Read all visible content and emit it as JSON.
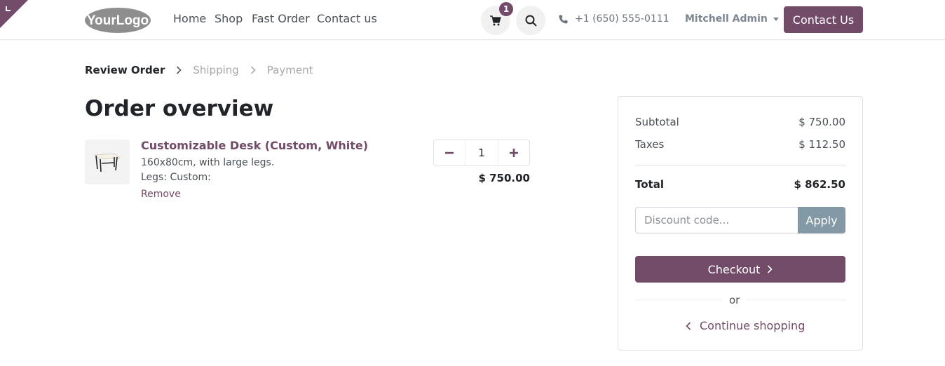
{
  "header": {
    "logo_text": "YourLogo",
    "nav": [
      "Home",
      "Shop",
      "Fast Order",
      "Contact us"
    ],
    "cart_count": "1",
    "phone": "+1 (650) 555-0111",
    "user": "Mitchell Admin",
    "contact_button": "Contact Us"
  },
  "steps": [
    "Review Order",
    "Shipping",
    "Payment"
  ],
  "page_title": "Order overview",
  "line_item": {
    "name": "Customizable Desk (Custom, White)",
    "description": "160x80cm, with large legs.",
    "attribute": "Legs: Custom:",
    "remove_label": "Remove",
    "quantity": "1",
    "price": "$ 750.00"
  },
  "summary": {
    "subtotal_label": "Subtotal",
    "subtotal": "$ 750.00",
    "taxes_label": "Taxes",
    "taxes": "$ 112.50",
    "total_label": "Total",
    "total": "$ 862.50",
    "discount_placeholder": "Discount code...",
    "apply_label": "Apply",
    "checkout_label": "Checkout",
    "or_label": "or",
    "continue_label": "Continue shopping"
  },
  "colors": {
    "brand": "#714b67",
    "apply": "#8499a6"
  },
  "icons": [
    "edit-corner-icon",
    "cart-icon",
    "search-icon",
    "phone-icon",
    "chevron-right-icon",
    "chevron-left-icon",
    "minus-icon",
    "plus-icon",
    "desk-icon"
  ]
}
